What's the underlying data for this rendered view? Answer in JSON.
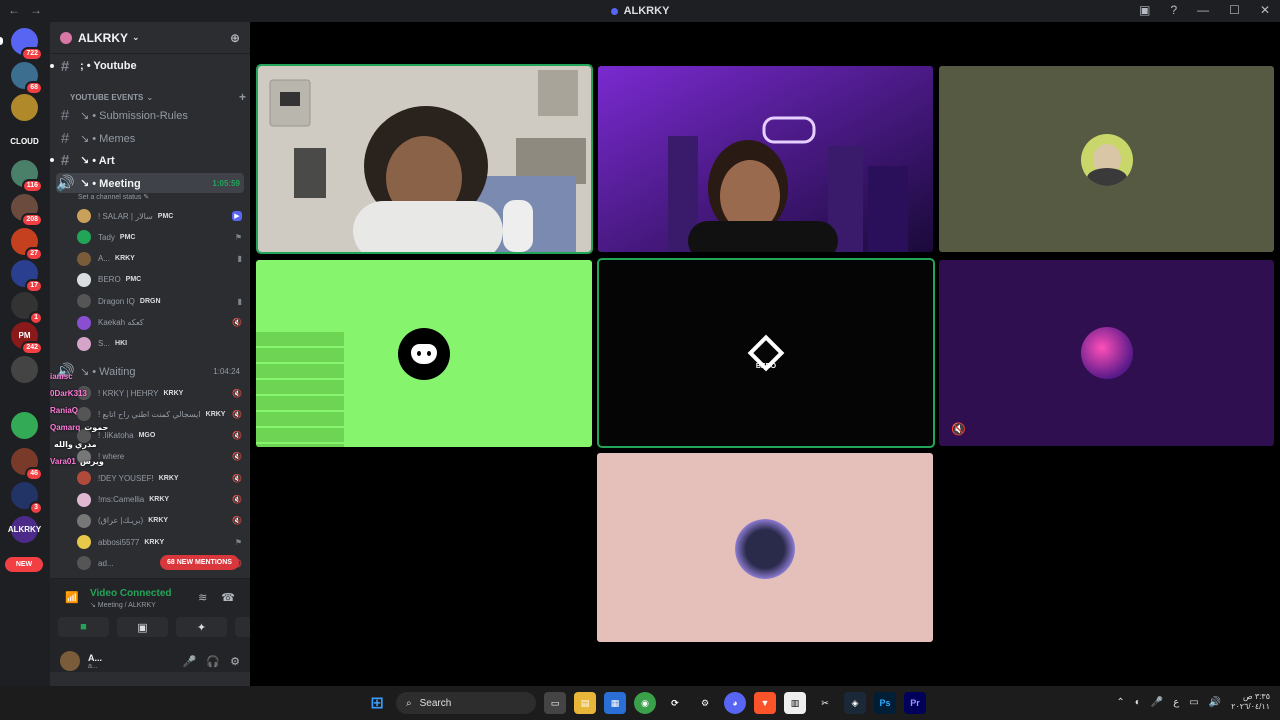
{
  "window": {
    "title": "ALKRKY",
    "nav_back": "←",
    "nav_fwd": "→",
    "inbox_icon": "▣",
    "help_icon": "?",
    "minimize": "—",
    "maximize": "☐",
    "close": "✕"
  },
  "guilds": [
    {
      "label": "",
      "badge": "722",
      "color": "#5865f2"
    },
    {
      "label": "",
      "badge": "68",
      "color": "#3b6e8f"
    },
    {
      "label": "",
      "badge": "",
      "color": "#b08a2a"
    },
    {
      "label": "CLOUD",
      "badge": "",
      "color": "transparent"
    },
    {
      "label": "",
      "badge": "116",
      "color": "#4a7f6a"
    },
    {
      "label": "",
      "badge": "208",
      "color": "#6b4b3e"
    },
    {
      "label": "",
      "badge": "27",
      "color": "#c4401f"
    },
    {
      "label": "",
      "badge": "17",
      "color": "#2a3f8f"
    },
    {
      "label": "",
      "badge": "1",
      "color": "#333"
    },
    {
      "label": "PM",
      "badge": "242",
      "color": "#8a1a1a"
    },
    {
      "label": "",
      "badge": "",
      "color": "#444"
    },
    {
      "label": "",
      "badge": "",
      "color": "#3a5"
    },
    {
      "label": "",
      "badge": "46",
      "color": "#7a3a2a"
    },
    {
      "label": "",
      "badge": "3",
      "color": "#223366"
    },
    {
      "label": "ALKRKY",
      "badge": "",
      "color": "#4b2a8a"
    }
  ],
  "guild_new_label": "NEW",
  "server": {
    "name": "ALKRKY"
  },
  "channels": {
    "youtube": "; • Youtube",
    "category_events": "YOUTUBE EVENTS",
    "submission_rules": "↘ • Submission-Rules",
    "memes": "↘ • Memes",
    "art": "↘ • Art",
    "meeting": "↘ • Meeting",
    "meeting_timer": "1:05:59",
    "meeting_status": "Set a channel status",
    "waiting": "↘ • Waiting",
    "waiting_timer": "1:04:24"
  },
  "voice_users": [
    {
      "name": "! SALAR | سالار",
      "tag": "PMC",
      "color": "#c9a15a"
    },
    {
      "name": "Tady",
      "tag": "PMC",
      "color": "#23a559"
    },
    {
      "name": "A...",
      "tag": "KRKY",
      "color": "#7a5c3a"
    },
    {
      "name": "BERO",
      "tag": "PMC",
      "color": "#dbdee1"
    },
    {
      "name": "Dragon IQ",
      "tag": "DRGN",
      "color": "#555"
    },
    {
      "name": "Kaekah كعكه",
      "tag": "",
      "color": "#8a4fd1"
    },
    {
      "name": "S...",
      "tag": "HKI",
      "color": "#d6a3c9"
    }
  ],
  "waiting_users": [
    {
      "name": "! KRKY | HEHRY",
      "tag": "KRKY",
      "color": "#555"
    },
    {
      "name": "! ايسجالي كمنت اطني راح اتابع",
      "tag": "KRKY",
      "color": "#555"
    },
    {
      "name": "! .liKatoha",
      "tag": "MGO",
      "color": "#555"
    },
    {
      "name": "! where",
      "tag": "",
      "color": "#777"
    },
    {
      "name": "!DEY YOUSEF!",
      "tag": "KRKY",
      "color": "#b04a3a"
    },
    {
      "name": "!ms:Camellia",
      "tag": "KRKY",
      "color": "#e0b7d0"
    },
    {
      "name": "(بريـك| عراق)",
      "tag": "KRKY",
      "color": "#777"
    },
    {
      "name": "abbosi5577",
      "tag": "KRKY",
      "color": "#e6c84a"
    },
    {
      "name": "ad...",
      "tag": "",
      "color": "#555"
    }
  ],
  "mentions_label": "68 NEW MENTIONS",
  "chat_overlay": [
    {
      "name": "iamsc",
      "text": ""
    },
    {
      "name": "0DarK313",
      "text": ""
    },
    {
      "name": "RaniaQ",
      "text": ""
    },
    {
      "name": "Qamarq",
      "text": "حموت"
    },
    {
      "name": "",
      "text": "مدري والله"
    },
    {
      "name": "Vara01",
      "text": "ويرس"
    }
  ],
  "voice_panel": {
    "title": "Video Connected",
    "subtitle": "↘ Meeting / ALKRKY",
    "user_name": "A...",
    "user_status": "a..."
  },
  "video_tiles": [
    {
      "id": "salar",
      "label": "",
      "bg": "#c9c4bd"
    },
    {
      "id": "tady",
      "label": "",
      "bg": "#4b1a7a"
    },
    {
      "id": "a",
      "label": "",
      "bg": "#565a43"
    },
    {
      "id": "green",
      "label": "",
      "bg": "#86f46c"
    },
    {
      "id": "bero",
      "label": "BERO",
      "bg": "#050505"
    },
    {
      "id": "kaekah",
      "label": "",
      "bg": "#2f0f4f"
    },
    {
      "id": "sakura",
      "label": "",
      "bg": "#e5c0ba"
    }
  ],
  "taskbar": {
    "search": "Search",
    "clock_time": "٣:٣٥ ص",
    "clock_date": "٢٠٢٦/٠٤/١١",
    "lang": "ع"
  },
  "colors": {
    "accent": "#5865f2",
    "speaking": "#23a559",
    "danger": "#f23f43"
  }
}
